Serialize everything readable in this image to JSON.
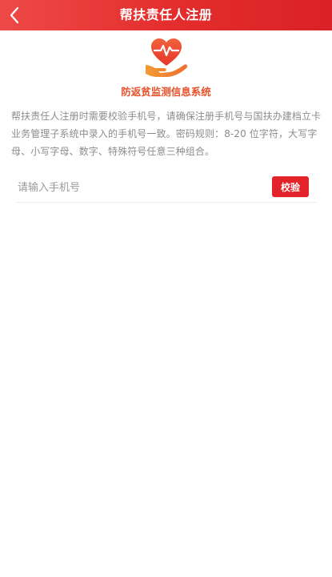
{
  "header": {
    "title": "帮扶责任人注册",
    "back_icon": "chevron-left-icon",
    "background_color": "#e32c2b"
  },
  "logo": {
    "icon": "heart-pulse-in-hand-icon",
    "text": "防返贫监测信息系统",
    "color": "#e8512a"
  },
  "notice": {
    "text": "帮扶责任人注册时需要校验手机号，请确保注册手机号与国扶办建档立卡业务管理子系统中录入的手机号一致。密码规则：8-20 位字符，大写字母、小写字母、数字、特殊符号任意三种组合。"
  },
  "phone_field": {
    "placeholder": "请输入手机号",
    "value": ""
  },
  "verify_button": {
    "label": "校验",
    "color": "#e2242a"
  }
}
